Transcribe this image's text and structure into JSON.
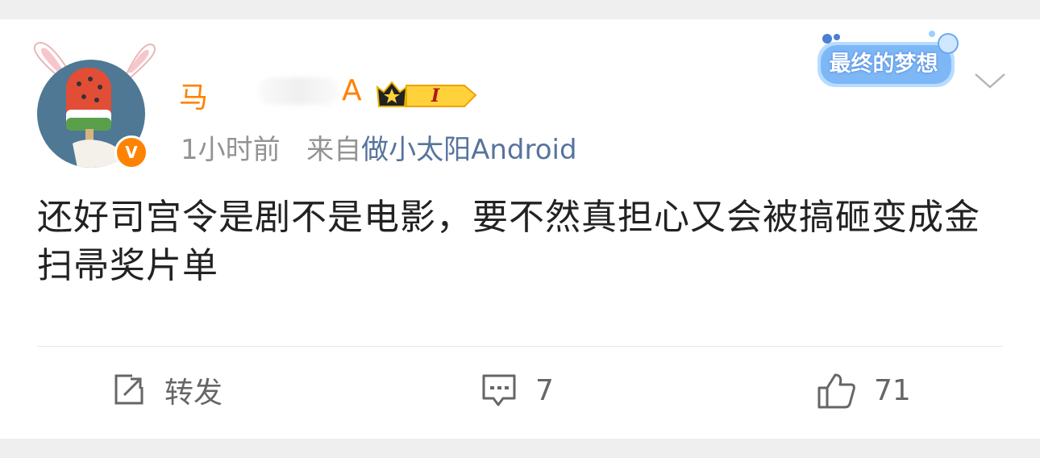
{
  "post": {
    "user": {
      "name_start": "马",
      "name_end": "A",
      "level": "I",
      "verified_symbol": "V"
    },
    "time": "1小时前",
    "source_prefix": "来自",
    "source": "做小太阳Android",
    "badge_text": "最终的梦想",
    "content": "还好司宫令是剧不是电影，要不然真担心又会被搞砸变成金扫帚奖片单"
  },
  "actions": {
    "repost_label": "转发",
    "comment_count": "7",
    "like_count": "71"
  },
  "icons": {
    "repost": "repost-icon",
    "comment": "comment-icon",
    "like": "thumbs-up-icon",
    "more": "chevron-down-icon",
    "crown": "crown-level-icon",
    "verified": "verified-v-icon"
  },
  "colors": {
    "accent": "#ff8200",
    "source_link": "#57749c",
    "meta": "#939393",
    "text": "#222222",
    "badge_blue": "#6ea8f0"
  }
}
